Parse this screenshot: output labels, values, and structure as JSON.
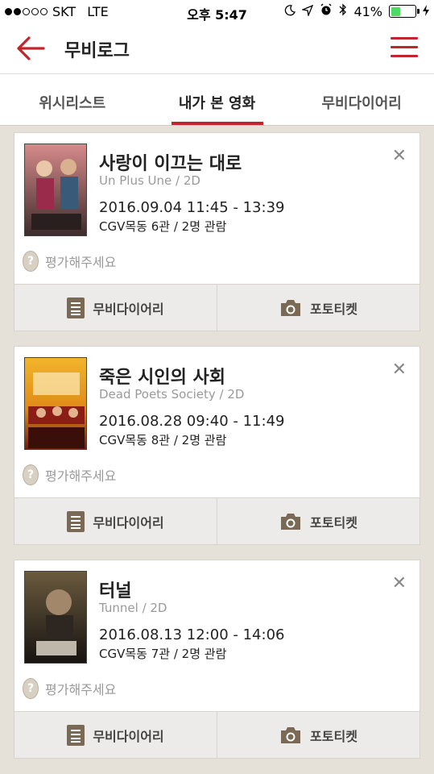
{
  "status_bar": {
    "carrier": "SKT",
    "network": "LTE",
    "time": "오후 5:47",
    "battery": "41%",
    "battery_level": 0.41
  },
  "nav": {
    "title": "무비로그"
  },
  "tabs": [
    {
      "label": "위시리스트",
      "active": false
    },
    {
      "label": "내가 본 영화",
      "active": true
    },
    {
      "label": "무비다이어리",
      "active": false
    }
  ],
  "movies": [
    {
      "title": "사랑이 이끄는 대로",
      "subtitle": "Un Plus Une / 2D",
      "datetime": "2016.09.04 11:45 - 13:39",
      "place": "CGV목동 6관 / 2명 관람",
      "rate_prompt": "평가해주세요",
      "poster_colors": [
        "#d68a8a",
        "#3b2a2a"
      ]
    },
    {
      "title": "죽은 시인의 사회",
      "subtitle": "Dead Poets Society / 2D",
      "datetime": "2016.08.28 09:40 - 11:49",
      "place": "CGV목동 8관 / 2명 관람",
      "rate_prompt": "평가해주세요",
      "poster_colors": [
        "#e8a21f",
        "#6b1b12"
      ]
    },
    {
      "title": "터널",
      "subtitle": "Tunnel / 2D",
      "datetime": "2016.08.13 12:00 - 14:06",
      "place": "CGV목동 7관 / 2명 관람",
      "rate_prompt": "평가해주세요",
      "poster_colors": [
        "#5a4a32",
        "#161210"
      ]
    }
  ],
  "actions": {
    "diary_label": "무비다이어리",
    "photo_label": "포토티켓"
  },
  "colors": {
    "accent": "#c0272d",
    "background": "#e5e1d9"
  }
}
